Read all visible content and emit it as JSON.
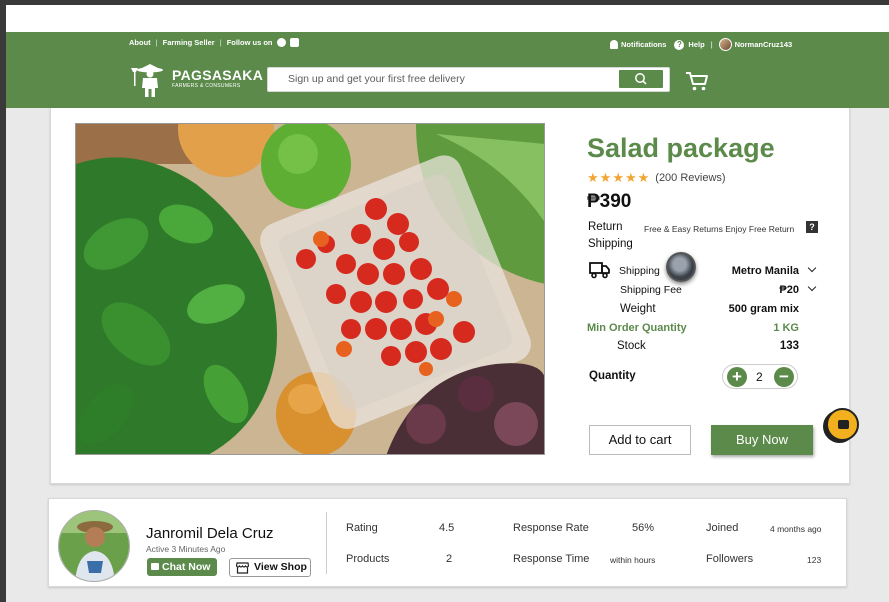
{
  "topbar": {
    "about": "About",
    "farming_seller": "Farming Seller",
    "follow_us": "Follow us on",
    "notifications": "Notifications",
    "help": "Help",
    "username": "NormanCruz143"
  },
  "brand": {
    "name": "PAGSASAKA",
    "tagline": "FARMERS & CONSUMERS"
  },
  "search": {
    "placeholder": "Sign up and get your first free delivery"
  },
  "product": {
    "title": "Salad package",
    "rating": 5,
    "reviews": "(200 Reviews)",
    "price": "₱390",
    "return_label": "Return",
    "return_note": "Free & Easy Returns Enjoy Free Return",
    "shipping_label": "Shipping",
    "shipping_to_label": "Shipping",
    "shipping_to_value": "Metro Manila",
    "shipping_fee_label": "Shipping Fee",
    "shipping_fee_value": "₱20",
    "weight_label": "Weight",
    "weight_value": "500 gram mix",
    "min_order_label": "Min Order Quantity",
    "min_order_value": "1 KG",
    "stock_label": "Stock",
    "stock_value": "133",
    "quantity_label": "Quantity",
    "quantity_value": "2",
    "add_to_cart": "Add to cart",
    "buy_now": "Buy Now"
  },
  "seller": {
    "name": "Janromil Dela Cruz",
    "active": "Active 3 Minutes Ago",
    "chat_now": "Chat Now",
    "view_shop": "View Shop",
    "stats": {
      "rating_label": "Rating",
      "rating_value": "4.5",
      "products_label": "Products",
      "products_value": "2",
      "response_rate_label": "Response Rate",
      "response_rate_value": "56%",
      "response_time_label": "Response Time",
      "response_time_value": "within hours",
      "joined_label": "Joined",
      "joined_value": "4 months ago",
      "followers_label": "Followers",
      "followers_value": "123"
    }
  },
  "colors": {
    "brand_green": "#5b8a4b",
    "star": "#f2a531",
    "chat_float": "#f2b01e"
  }
}
